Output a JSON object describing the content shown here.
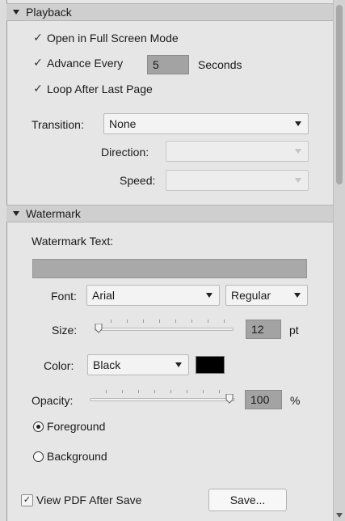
{
  "playback": {
    "header": "Playback",
    "open_full_screen": {
      "label": "Open in Full Screen Mode",
      "checked": true
    },
    "advance_every": {
      "label": "Advance Every",
      "value": "5",
      "unit": "Seconds",
      "checked": true
    },
    "loop_after_last_page": {
      "label": "Loop After Last Page",
      "checked": true
    },
    "transition": {
      "label": "Transition:",
      "value": "None"
    },
    "direction": {
      "label": "Direction:",
      "value": ""
    },
    "speed": {
      "label": "Speed:",
      "value": ""
    }
  },
  "watermark": {
    "header": "Watermark",
    "text_label": "Watermark Text:",
    "text_value": "",
    "font": {
      "label": "Font:",
      "value": "Arial",
      "style": "Regular"
    },
    "size": {
      "label": "Size:",
      "value": "12",
      "unit": "pt",
      "level": 0
    },
    "color": {
      "label": "Color:",
      "value": "Black",
      "swatch": "#000000"
    },
    "opacity": {
      "label": "Opacity:",
      "value": "100",
      "unit": "%",
      "level": 1
    },
    "foreground": {
      "label": "Foreground",
      "selected": true
    },
    "background": {
      "label": "Background",
      "selected": false
    }
  },
  "footer": {
    "view_pdf_after_save": {
      "label": "View PDF After Save",
      "checked": true
    },
    "save_button": "Save..."
  }
}
